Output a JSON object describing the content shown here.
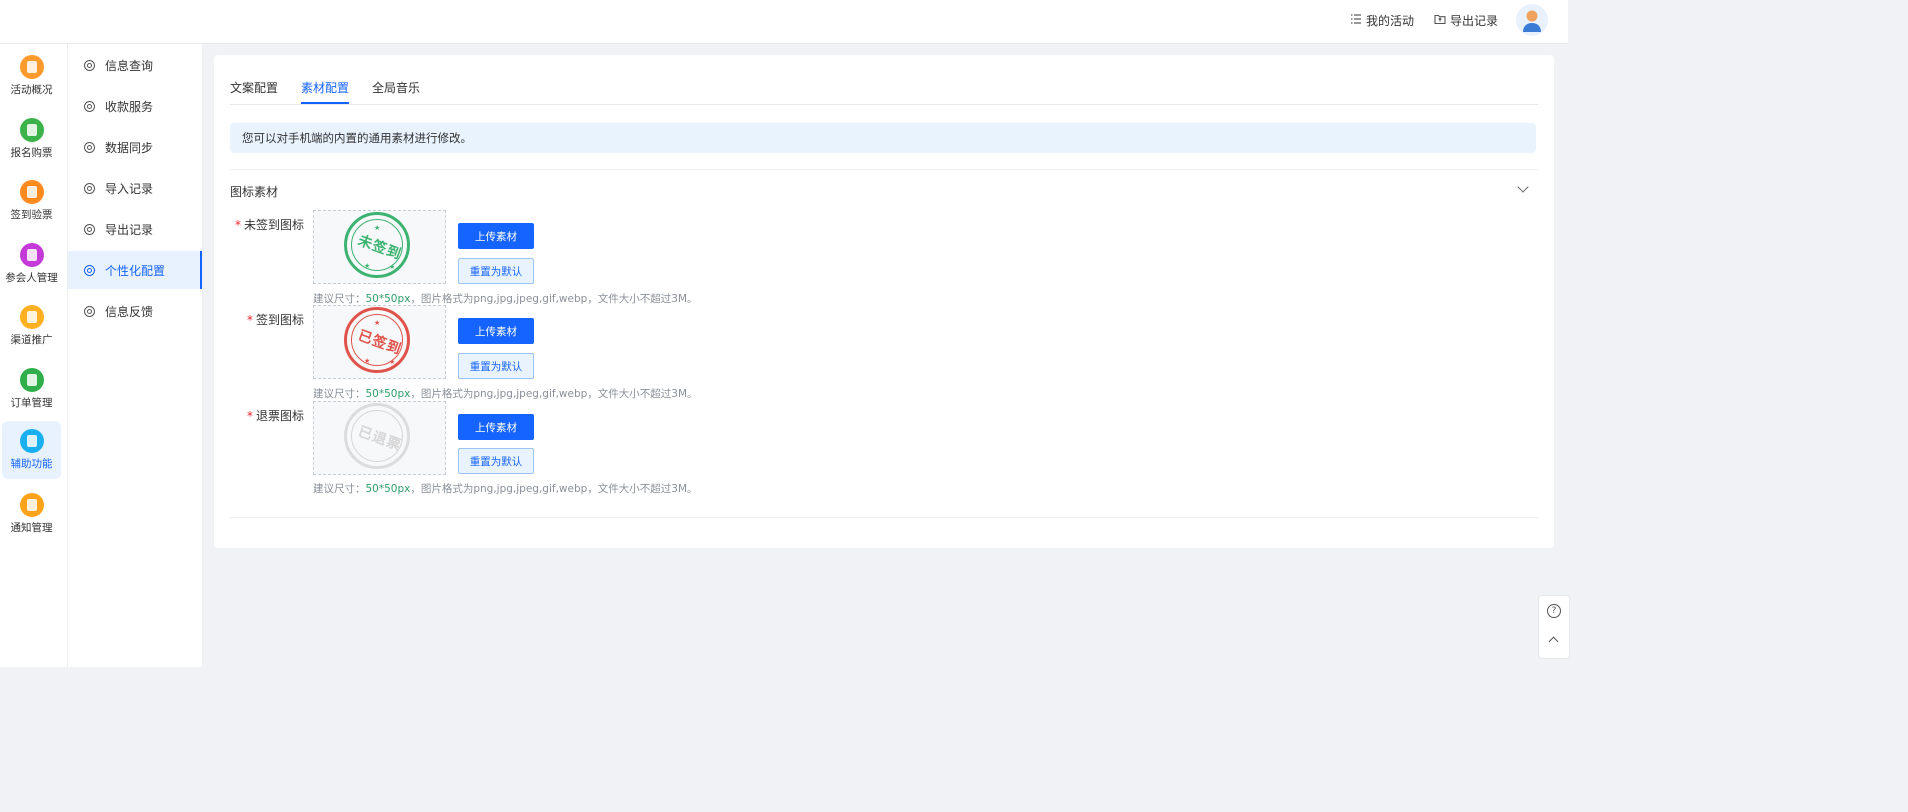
{
  "topbar": {
    "my_activity": "我的活动",
    "export_records": "导出记录"
  },
  "rail": {
    "items": [
      {
        "label": "活动概况",
        "color": "#ff9a2e",
        "icon": "id-card-icon"
      },
      {
        "label": "报名购票",
        "color": "#3cb34a",
        "icon": "ticket-icon"
      },
      {
        "label": "签到验票",
        "color": "#ff8a1f",
        "icon": "check-in-icon"
      },
      {
        "label": "参会人管理",
        "color": "#c43ad8",
        "icon": "attendee-icon"
      },
      {
        "label": "渠道推广",
        "color": "#ffb020",
        "icon": "channel-icon"
      },
      {
        "label": "订单管理",
        "color": "#2fae4a",
        "icon": "order-icon"
      },
      {
        "label": "辅助功能",
        "color": "#1ab0f0",
        "icon": "assist-icon"
      },
      {
        "label": "通知管理",
        "color": "#ffa31a",
        "icon": "bell-icon"
      }
    ]
  },
  "submenu": {
    "items": [
      {
        "label": "信息查询"
      },
      {
        "label": "收款服务"
      },
      {
        "label": "数据同步"
      },
      {
        "label": "导入记录"
      },
      {
        "label": "导出记录"
      },
      {
        "label": "个性化配置"
      },
      {
        "label": "信息反馈"
      }
    ]
  },
  "tabs": [
    {
      "label": "文案配置"
    },
    {
      "label": "素材配置"
    },
    {
      "label": "全局音乐"
    }
  ],
  "notice": "您可以对手机端的内置的通用素材进行修改。",
  "section": {
    "title": "图标素材"
  },
  "rows": [
    {
      "label": "未签到图标",
      "stamp_text": "未签到",
      "stamp_color": "#3cb371"
    },
    {
      "label": "签到图标",
      "stamp_text": "已签到",
      "stamp_color": "#e0534a"
    },
    {
      "label": "退票图标",
      "stamp_text": "已退票",
      "stamp_color": "#d6d6d6"
    }
  ],
  "buttons": {
    "upload": "上传素材",
    "reset": "重置为默认"
  },
  "hint": {
    "prefix": "建议尺寸：",
    "size": "50*50px",
    "suffix": "，图片格式为png,jpg,jpeg,gif,webp，文件大小不超过3M。"
  },
  "required_mark": "*"
}
